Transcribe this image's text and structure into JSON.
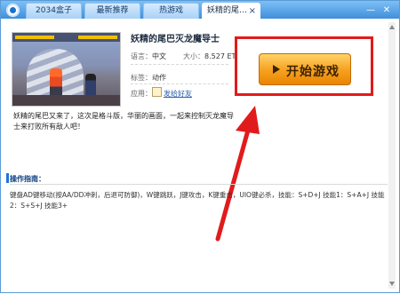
{
  "window": {
    "tabs": [
      {
        "label": "2034盒子"
      },
      {
        "label": "最新推荐"
      },
      {
        "label": "热游戏"
      },
      {
        "label": "妖精的尾…"
      }
    ],
    "active_tab_close": "×",
    "controls": {
      "minimize": "—",
      "close": "✕"
    }
  },
  "game": {
    "title": "妖精的尾巴灭龙魔导士",
    "language_key": "语言：",
    "language_value": "中文",
    "size_key": "大小：",
    "size_value": "8.527 ET",
    "tags_key": "标签：",
    "tags_value": "动作",
    "apps_key": "应用：",
    "share_label": "发给好友",
    "description": "妖精的尾巴又来了，这次是格斗版，华丽的画面，一起来控制灭龙魔导士来打败所有敌人吧！"
  },
  "start_button": {
    "label": "开始游戏"
  },
  "guide": {
    "title": "操作指南：",
    "text": "键盘AD键移动(按AA/DD冲刺，后退可防御)，W键跳跃，J键攻击，K键重击，UIO键必杀，技能：S+D+J 技能1：S+A+J 技能2：S+S+J 技能3+"
  },
  "colors": {
    "title_bar": "#3f8fdc",
    "accent_orange": "#f7a323",
    "annotation_red": "#e11b1b",
    "link": "#2a5fb0"
  },
  "icons": [
    "app-logo-icon",
    "close-icon",
    "minimize-icon",
    "play-icon",
    "share-icon"
  ]
}
